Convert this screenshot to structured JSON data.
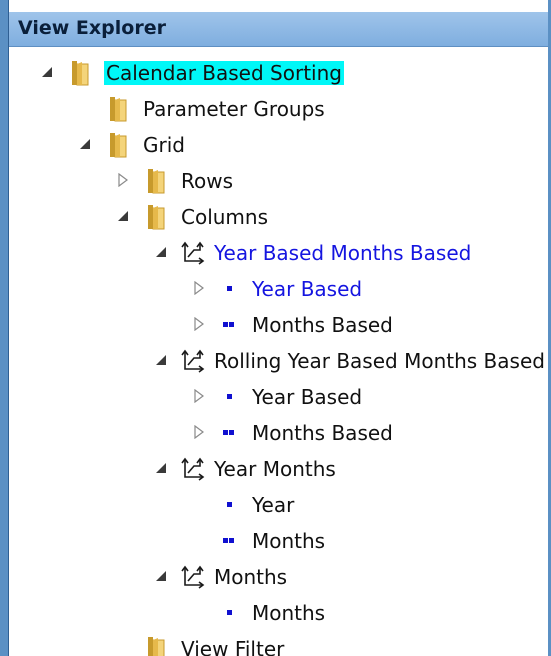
{
  "panel": {
    "title": "View Explorer"
  },
  "tree": {
    "root": "Calendar Based Sorting",
    "parameter_groups": "Parameter Groups",
    "grid": "Grid",
    "rows": "Rows",
    "columns": "Columns",
    "col1": {
      "label": "Year Based Months Based",
      "year": "Year Based",
      "months": "Months Based"
    },
    "col2": {
      "label": "Rolling Year Based Months Based",
      "year": "Year Based",
      "months": "Months Based"
    },
    "col3": {
      "label": "Year Months",
      "year": "Year",
      "months": "Months"
    },
    "col4": {
      "label": "Months",
      "months": "Months"
    },
    "view_filter": "View Filter"
  },
  "colors": {
    "selection": "#00f7f7",
    "level_blue": "#1010d0",
    "title_bar": "#8fb8e6"
  },
  "icons": {
    "folder": "folder-icon",
    "hierarchy": "hierarchy-icon",
    "level": "level-icon",
    "expanded": "expanded-arrow-icon",
    "collapsed": "collapsed-arrow-icon"
  }
}
